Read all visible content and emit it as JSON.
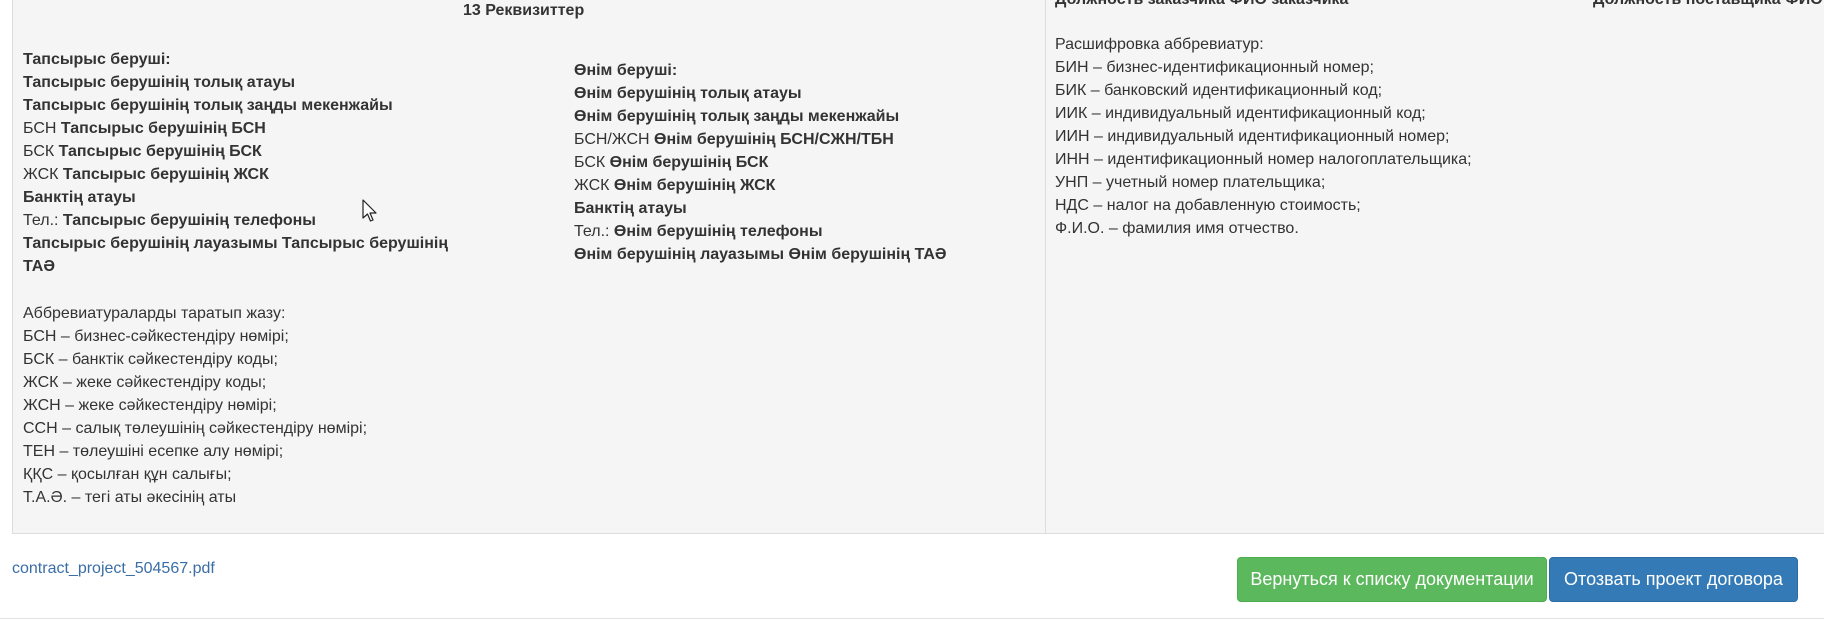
{
  "section": {
    "title": "13 Реквизиттер"
  },
  "cut_headers": {
    "left": "Должность заказчика ФИО заказчика",
    "right": "Должность поставщика ФИО"
  },
  "customer": {
    "heading": "Тапсырыс беруші:",
    "full_name": "Тапсырыс берушінің толық атауы",
    "legal_address": "Тапсырыс берушінің толық заңды мекенжайы",
    "bsn_prefix": "БСН",
    "bsn_value": "Тапсырыс берушінің БСН",
    "bsk_prefix": "БСК",
    "bsk_value": "Тапсырыс берушінің БСК",
    "zhsk_prefix": "ЖСК",
    "zhsk_value": "Тапсырыс берушінің ЖСК",
    "bank": "Банктің атауы",
    "phone_prefix": "Тел.:",
    "phone_value": "Тапсырыс берушінің телефоны",
    "signature": "Тапсырыс берушінің лауазымы Тапсырыс берушінің ТАӘ"
  },
  "producer": {
    "heading": "Өнім беруші:",
    "full_name": "Өнім берушінің толық атауы",
    "legal_address": "Өнім берушінің толық заңды мекенжайы",
    "bsn_prefix": "БСН/ЖСН",
    "bsn_value": "Өнім берушінің БСН/СЖН/ТБН",
    "bsk_prefix": "БСК",
    "bsk_value": "Өнім берушінің БСК",
    "zhsk_prefix": "ЖСК",
    "zhsk_value": "Өнім берушінің ЖСК",
    "bank": "Банктің атауы",
    "phone_prefix": "Тел.:",
    "phone_value": "Өнім берушінің телефоны",
    "signature": "Өнім берушінің лауазымы Өнім берушінің ТАӘ"
  },
  "abbr_kz": {
    "heading": "Аббревиатураларды таратып жазу:",
    "items": [
      "БСН – бизнес-сәйкестендіру нөмірі;",
      "БСК – банктік сәйкестендіру коды;",
      "ЖСК – жеке сәйкестендіру коды;",
      "ЖСН – жеке сәйкестендіру нөмірі;",
      "ССН – салық төлеушінің сәйкестендіру нөмірі;",
      "ТЕН – төлеушіні есепке алу нөмірі;",
      "ҚҚС – қосылған құн салығы;",
      "Т.А.Ә. – тегі аты әкесінің аты"
    ]
  },
  "abbr_ru": {
    "heading": "Расшифровка аббревиатур:",
    "items": [
      "БИН – бизнес-идентификационный номер;",
      "БИК – банковский идентификационный код;",
      "ИИК – индивидуальный идентификационный код;",
      "ИИН – индивидуальный идентификационный номер;",
      "ИНН – идентификационный номер налогоплательщика;",
      "УНП – учетный номер плательщика;",
      "НДС – налог на добавленную стоимость;",
      "Ф.И.О. – фамилия имя отчество."
    ]
  },
  "footer": {
    "pdf_link": "contract_project_504567.pdf",
    "back_button": "Вернуться к списку документации",
    "withdraw_button": "Отозвать проект договора"
  },
  "colors": {
    "green_button": "#5cb85c",
    "blue_button": "#337ab7",
    "link": "#3a6ea5",
    "panel_bg": "#f5f5f5"
  },
  "icons": {
    "cursor": "mouse-pointer-icon"
  }
}
